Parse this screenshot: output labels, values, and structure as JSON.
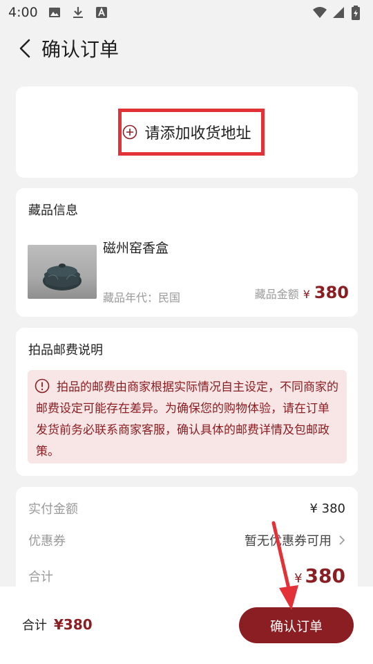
{
  "status_bar": {
    "time": "4:00",
    "icons_left": [
      "image-icon",
      "download-icon",
      "text-a-icon"
    ],
    "icons_right": [
      "wifi-icon",
      "signal-icon",
      "battery-icon"
    ]
  },
  "header": {
    "title": "确认订单"
  },
  "address": {
    "add_label": "请添加收货地址"
  },
  "item_section": {
    "title": "藏品信息",
    "name": "磁州窑香盒",
    "era_label": "藏品年代：",
    "era_value": "民国",
    "price_label": "藏品金额",
    "currency": "¥",
    "price": "380"
  },
  "shipping_section": {
    "title": "拍品邮费说明",
    "notice": "拍品的邮费由商家根据实际情况自主设定，不同商家的邮费设定可能存在差异。为确保您的购物体验，请在订单发货前务必联系商家客服，确认具体的邮费详情及包邮政策。"
  },
  "summary": {
    "paid_label": "实付金额",
    "paid_value": "¥ 380",
    "coupon_label": "优惠券",
    "coupon_value": "暂无优惠券可用",
    "total_label": "合计",
    "total_currency": "¥",
    "total_value": "380"
  },
  "bottom_bar": {
    "total_label": "合计",
    "total_price": "¥380",
    "confirm_label": "确认订单"
  },
  "colors": {
    "accent": "#8b1e22",
    "highlight_box": "#e33237",
    "notice_bg": "#f8e6e6",
    "page_bg": "#f2f2f2"
  }
}
